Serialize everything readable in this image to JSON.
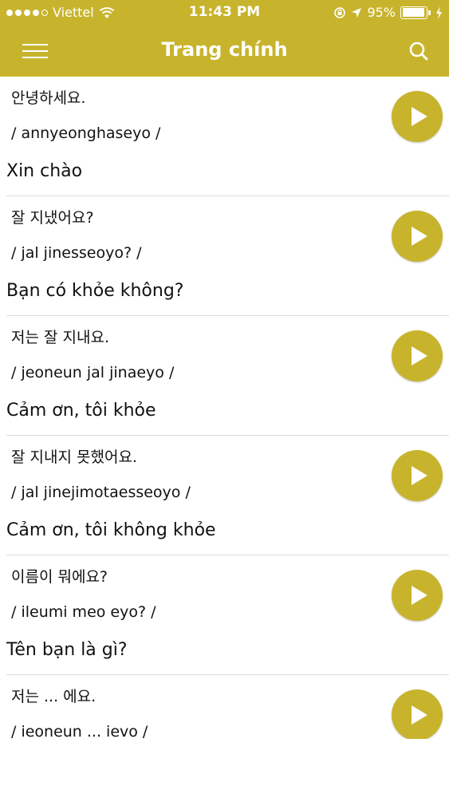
{
  "status_bar": {
    "carrier": "Viettel",
    "time": "11:43 PM",
    "battery": "95%",
    "battery_level": 0.95
  },
  "nav": {
    "title": "Trang chính",
    "menu_icon": "hamburger-menu-icon",
    "search_icon": "search-icon"
  },
  "colors": {
    "accent": "#c8b42c",
    "text": "#111111",
    "divider": "#dcdcdc"
  },
  "phrases": [
    {
      "korean": "안녕하세요.",
      "romanization": "/ annyeonghaseyo /",
      "translation": "Xin chào"
    },
    {
      "korean": "잘 지냈어요?",
      "romanization": "/ jal jinesseoyo? /",
      "translation": "Bạn có khỏe không?"
    },
    {
      "korean": "저는 잘 지내요.",
      "romanization": "/ jeoneun jal jinaeyo /",
      "translation": "Cảm ơn, tôi khỏe"
    },
    {
      "korean": "잘 지내지 못했어요.",
      "romanization": "/ jal jinejimotaesseoyo /",
      "translation": "Cảm ơn, tôi không khỏe"
    },
    {
      "korean": "이름이 뭐에요?",
      "romanization": "/ ileumi meo eyo? /",
      "translation": "Tên bạn là gì?"
    },
    {
      "korean": "저는 ... 에요.",
      "romanization": "/ ieoneun ... ievo /",
      "translation": ""
    }
  ]
}
